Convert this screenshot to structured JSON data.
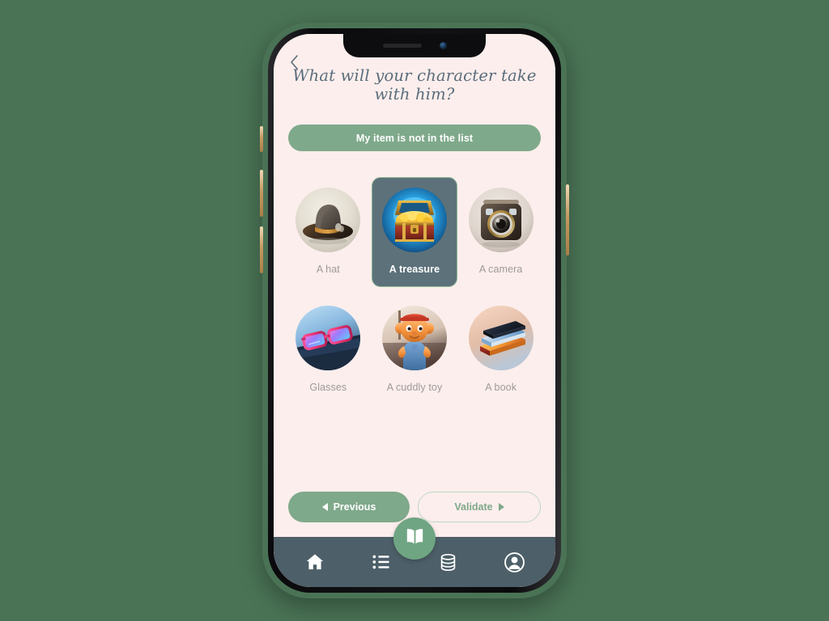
{
  "screen": {
    "background_color": "#fceeec",
    "outer_background_color": "#4a7355",
    "accent_green": "#7fa98b",
    "nav_bar_color": "#4d5f68",
    "selected_card_color": "#5d717a",
    "title_color": "#5a6d7c"
  },
  "header": {
    "back_icon": "chevron-left-icon",
    "title": "What will your character take with him?",
    "not_in_list_label": "My item is not in the list"
  },
  "items": [
    {
      "label": "A hat",
      "icon": "hat-icon",
      "selected": false
    },
    {
      "label": "A treasure",
      "icon": "treasure-icon",
      "selected": true
    },
    {
      "label": "A camera",
      "icon": "camera-icon",
      "selected": false
    },
    {
      "label": "Glasses",
      "icon": "glasses-icon",
      "selected": false
    },
    {
      "label": "A cuddly toy",
      "icon": "cuddly-toy-icon",
      "selected": false
    },
    {
      "label": "A book",
      "icon": "book-icon",
      "selected": false
    }
  ],
  "footer": {
    "previous_label": "Previous",
    "previous_icon": "triangle-left-icon",
    "validate_label": "Validate",
    "validate_icon": "triangle-right-icon"
  },
  "bottom_nav": {
    "items": [
      {
        "icon": "home-icon",
        "name": "nav-home"
      },
      {
        "icon": "list-icon",
        "name": "nav-list"
      },
      {
        "icon": "book-open-icon",
        "name": "nav-story",
        "center": true
      },
      {
        "icon": "database-icon",
        "name": "nav-library"
      },
      {
        "icon": "account-icon",
        "name": "nav-account"
      }
    ]
  }
}
